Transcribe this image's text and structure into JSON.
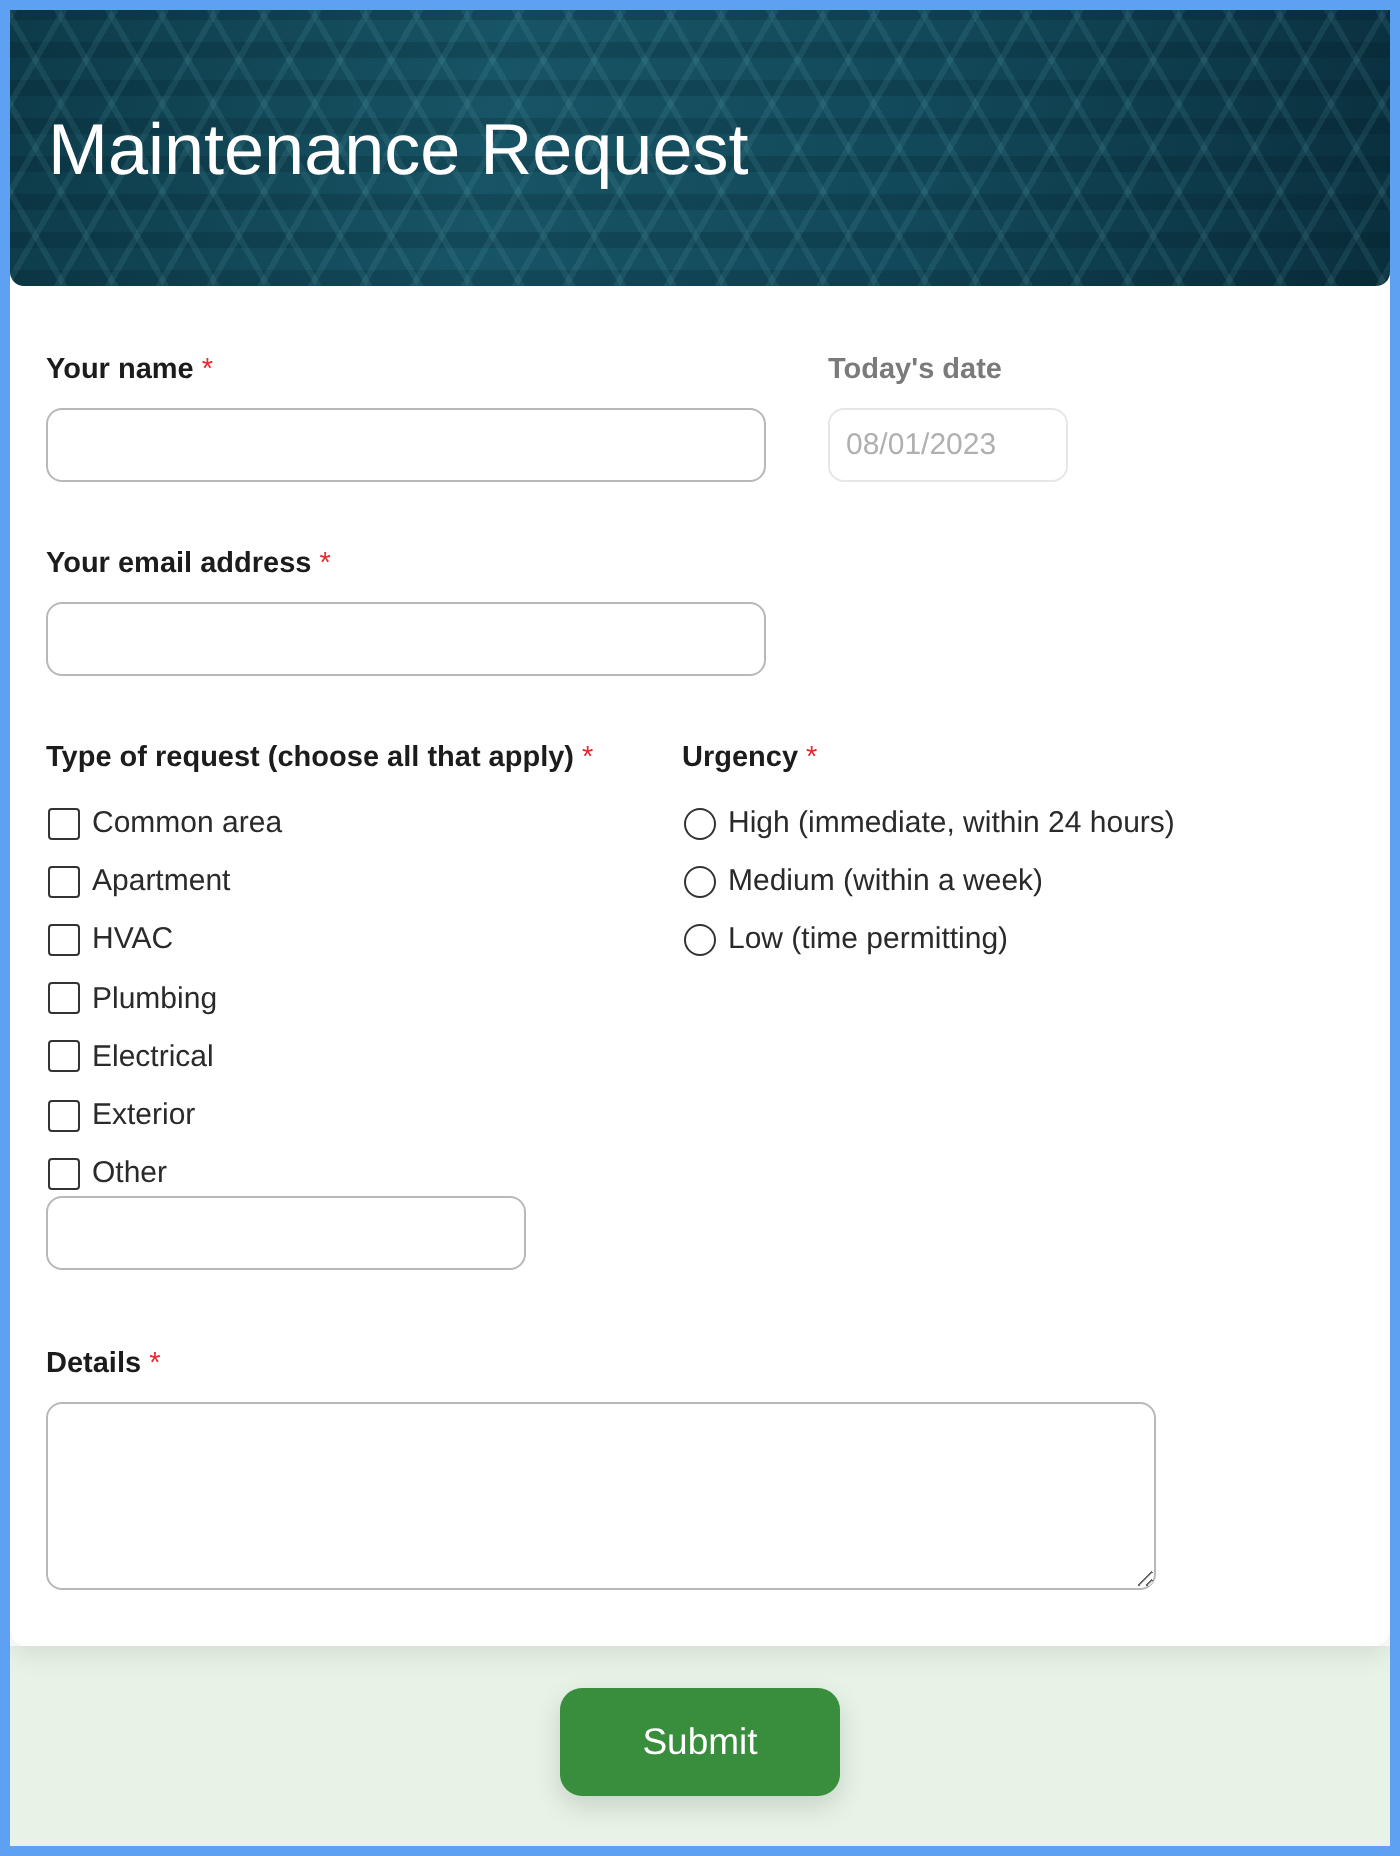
{
  "header": {
    "title": "Maintenance Request"
  },
  "name_field": {
    "label": "Your name",
    "required_mark": "*"
  },
  "date_field": {
    "label": "Today's date",
    "value": "08/01/2023",
    "disabled": true
  },
  "email_field": {
    "label": "Your email address",
    "required_mark": "*"
  },
  "request_types": {
    "label": "Type of request (choose all that apply)",
    "required_mark": "*",
    "options": [
      {
        "label": "Common area",
        "checked": false
      },
      {
        "label": "Apartment",
        "checked": false
      },
      {
        "label": "HVAC",
        "checked": false
      },
      {
        "label": "Plumbing",
        "checked": false
      },
      {
        "label": "Electrical",
        "checked": false
      },
      {
        "label": "Exterior",
        "checked": false
      },
      {
        "label": "Other",
        "checked": false
      }
    ]
  },
  "urgency": {
    "label": "Urgency",
    "required_mark": "*",
    "options": [
      {
        "label": "High (immediate, within 24 hours)",
        "selected": false
      },
      {
        "label": "Medium (within a week)",
        "selected": false
      },
      {
        "label": "Low (time permitting)",
        "selected": false
      }
    ]
  },
  "details": {
    "label": "Details",
    "required_mark": "*"
  },
  "submit_button": {
    "label": "Submit"
  }
}
